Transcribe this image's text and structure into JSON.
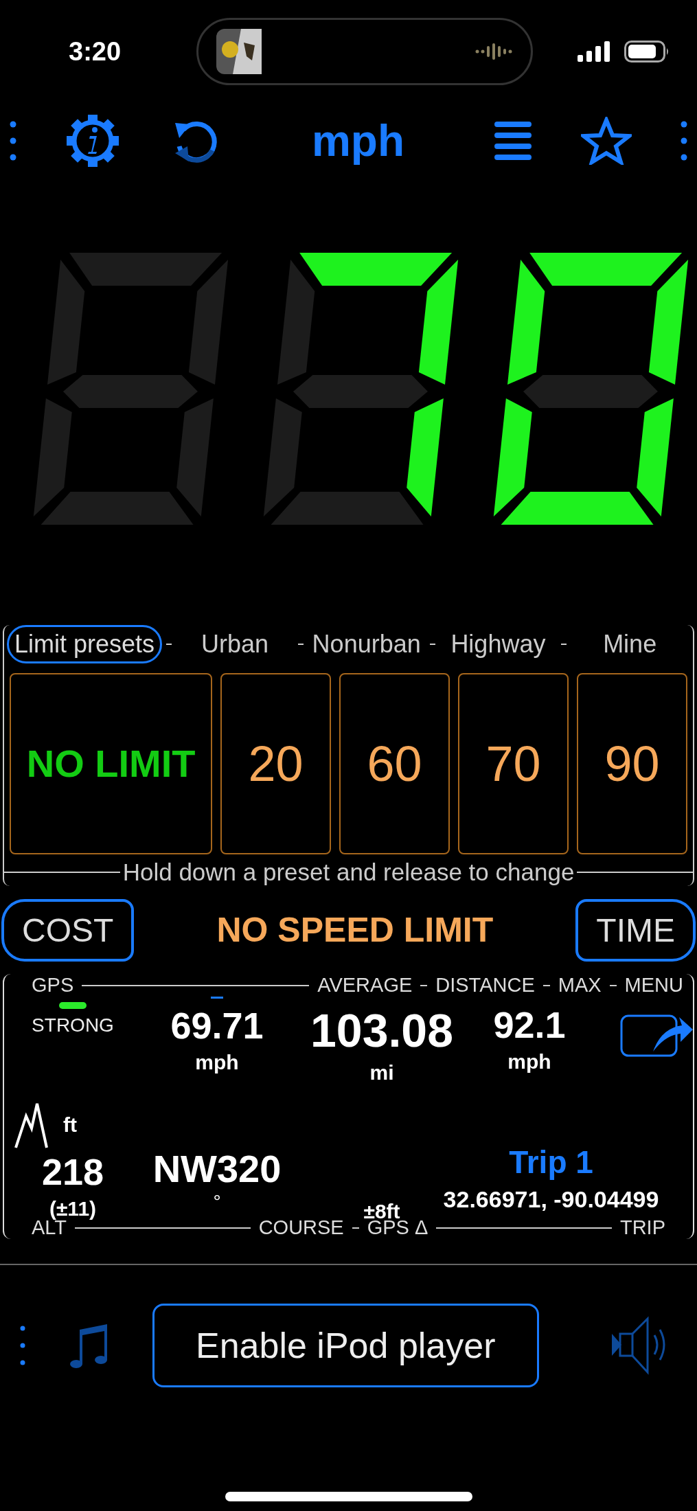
{
  "status_bar": {
    "time": "3:20"
  },
  "toolbar": {
    "unit": "mph"
  },
  "speed_display": {
    "digits": [
      {
        "segments": [
          false,
          false,
          false,
          false,
          false,
          false,
          false
        ]
      },
      {
        "segments": [
          true,
          true,
          true,
          false,
          false,
          false,
          false
        ]
      },
      {
        "segments": [
          true,
          true,
          true,
          true,
          true,
          true,
          false
        ]
      }
    ]
  },
  "presets": {
    "title": "Limit presets",
    "labels": [
      "Urban",
      "Nonurban",
      "Highway",
      "Mine"
    ],
    "items": [
      {
        "value": "NO LIMIT",
        "selected": true
      },
      {
        "value": "20",
        "selected": false
      },
      {
        "value": "60",
        "selected": false
      },
      {
        "value": "70",
        "selected": false
      },
      {
        "value": "90",
        "selected": false
      }
    ],
    "hint": "Hold down a preset and release to change"
  },
  "limit_bar": {
    "left_button": "COST",
    "status": "NO SPEED LIMIT",
    "right_button": "TIME"
  },
  "stats": {
    "top_labels": [
      "GPS",
      "AVERAGE",
      "DISTANCE",
      "MAX",
      "MENU"
    ],
    "gps_strength": "STRONG",
    "average": {
      "value": "69.71",
      "unit": "mph"
    },
    "distance": {
      "value": "103.08",
      "unit": "mi"
    },
    "max": {
      "value": "92.1",
      "unit": "mph"
    },
    "altitude": {
      "unit": "ft",
      "value": "218",
      "accuracy": "(±11)"
    },
    "course": {
      "value": "NW320",
      "unit": "°"
    },
    "gps_delta": "±8ft",
    "trip": {
      "name": "Trip 1",
      "coordinates": "32.66971, -90.04499"
    },
    "bottom_labels": [
      "ALT",
      "COURSE",
      "GPS Δ",
      "TRIP"
    ]
  },
  "player": {
    "button": "Enable iPod player"
  }
}
